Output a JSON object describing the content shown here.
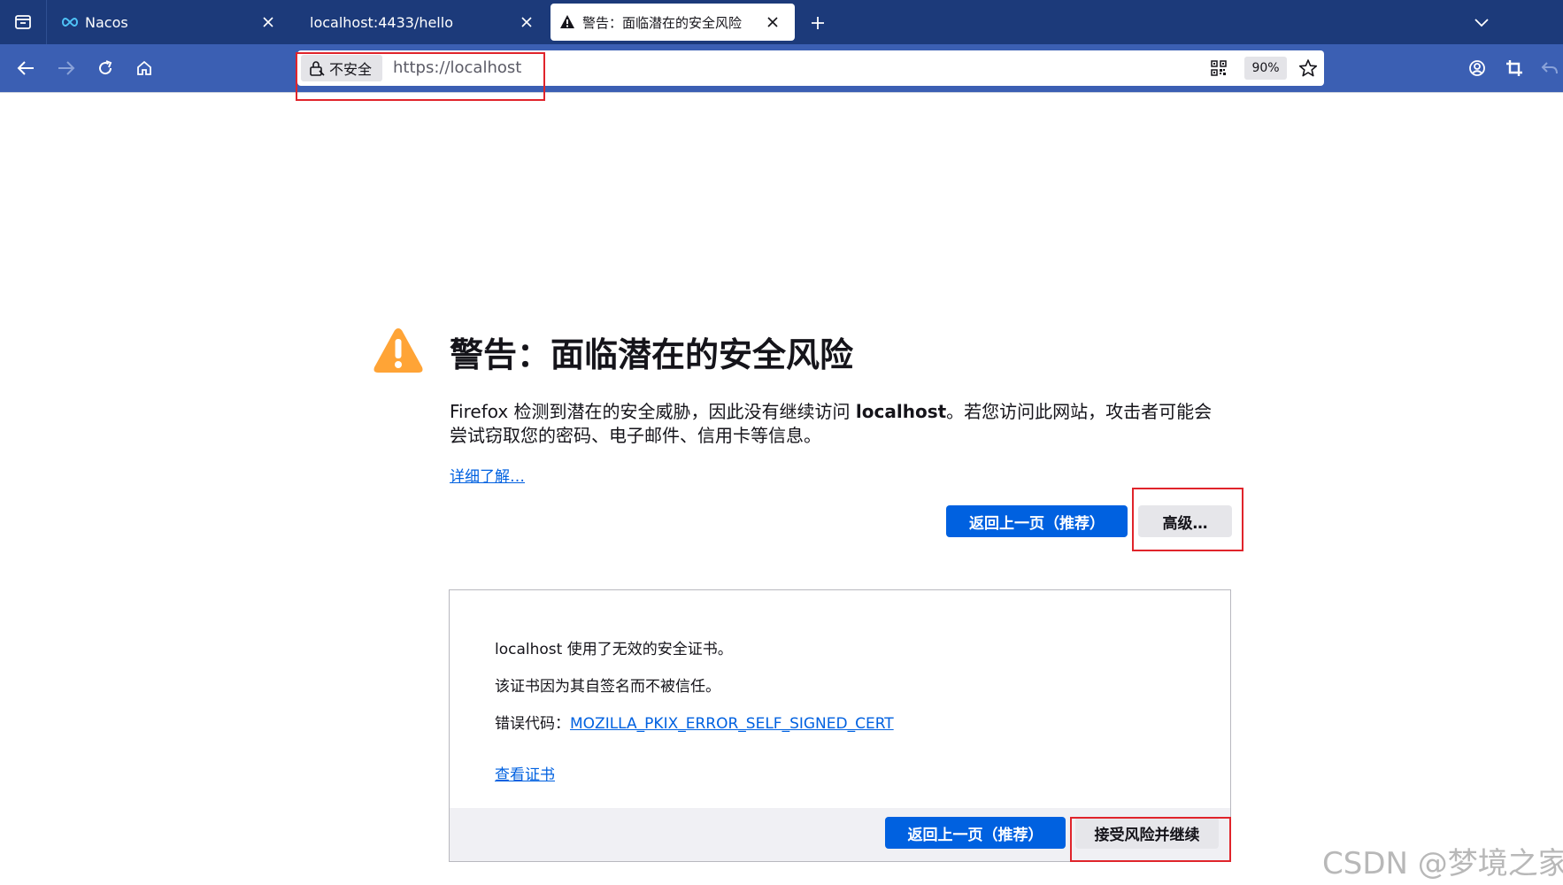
{
  "tabs": [
    {
      "label": "Nacos",
      "favicon": "nacos-infinity-icon",
      "close": "×"
    },
    {
      "label": "localhost:4433/hello",
      "close": "×"
    },
    {
      "label": "警告：面临潜在的安全风险",
      "favicon": "warning-icon",
      "close": "×",
      "active": true
    }
  ],
  "toolbar": {
    "new_tab": "+",
    "insecure_label": "不安全",
    "url": "https://localhost",
    "zoom": "90%"
  },
  "page": {
    "title": "警告：面临潜在的安全风险",
    "intro_before": "Firefox 检测到潜在的安全威胁，因此没有继续访问 ",
    "intro_host": "localhost",
    "intro_after": "。若您访问此网站，攻击者可能会尝试窃取您的密码、电子邮件、信用卡等信息。",
    "learn_more": "详细了解…",
    "go_back_label": "返回上一页（推荐）",
    "advanced_label": "高级…"
  },
  "advanced": {
    "line1": "localhost 使用了无效的安全证书。",
    "line2": "该证书因为其自签名而不被信任。",
    "error_code_prefix": "错误代码：",
    "error_code": "MOZILLA_PKIX_ERROR_SELF_SIGNED_CERT",
    "view_cert": "查看证书",
    "go_back_label": "返回上一页（推荐）",
    "accept_label": "接受风险并继续"
  },
  "watermark": "CSDN @梦境之家",
  "colors": {
    "tabbar": "#1c3a7a",
    "navbar": "#3b5fb3",
    "primary_button": "#0061e0",
    "warning_icon": "#ffa436",
    "highlight_box": "#e0242b"
  }
}
